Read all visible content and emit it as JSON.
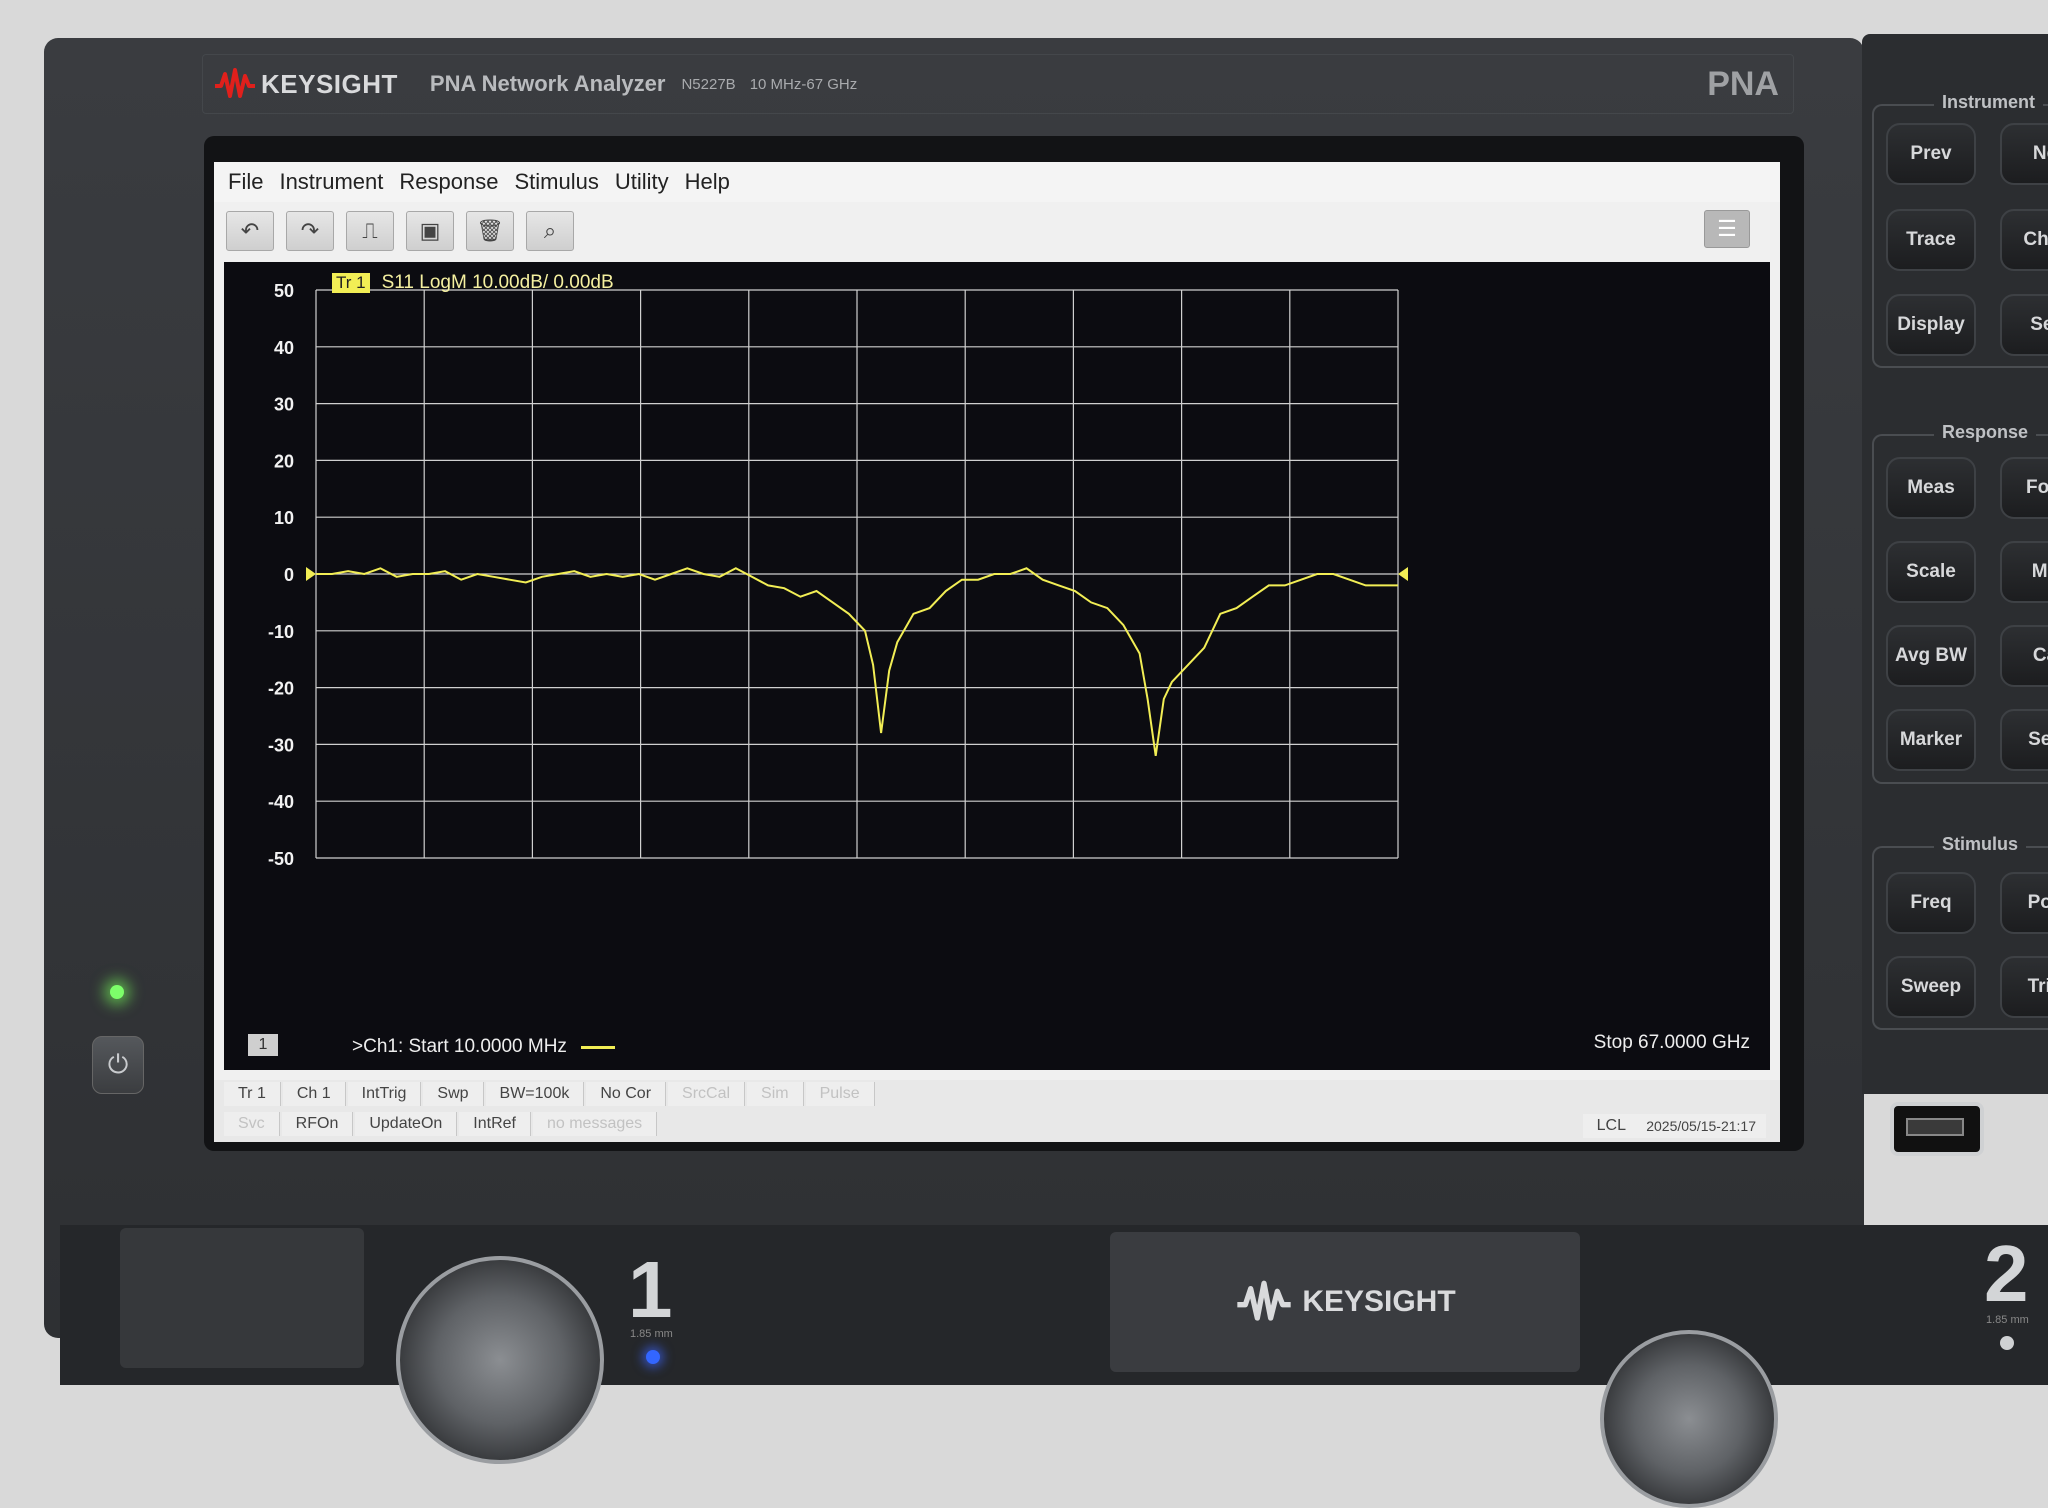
{
  "brand": {
    "name": "KEYSIGHT",
    "model": "PNA Network Analyzer",
    "part": "N5227B",
    "range": "10 MHz-67 GHz",
    "series": "PNA"
  },
  "menu": [
    "File",
    "Instrument",
    "Response",
    "Stimulus",
    "Utility",
    "Help"
  ],
  "toolbar": {
    "icons": [
      "undo-icon",
      "redo-icon",
      "add-trace-icon",
      "screen-capture-icon",
      "delete-icon",
      "zoom-icon"
    ]
  },
  "trace": {
    "badge": "Tr 1",
    "label": "S11 LogM 10.00dB/ 0.00dB",
    "color": "#f2ee55"
  },
  "channel": {
    "badge": "1",
    "start": ">Ch1:  Start  10.0000 MHz",
    "stop": "Stop  67.0000 GHz"
  },
  "status": {
    "row1": [
      {
        "text": "Tr 1",
        "dim": false
      },
      {
        "text": "Ch 1",
        "dim": false
      },
      {
        "text": "IntTrig",
        "dim": false
      },
      {
        "text": "Swp",
        "dim": false
      },
      {
        "text": "BW=100k",
        "dim": false
      },
      {
        "text": "No Cor",
        "dim": false
      },
      {
        "text": "SrcCal",
        "dim": true
      },
      {
        "text": "Sim",
        "dim": true
      },
      {
        "text": "Pulse",
        "dim": true
      }
    ],
    "row2": [
      {
        "text": "Svc",
        "dim": true
      },
      {
        "text": "RFOn",
        "dim": false
      },
      {
        "text": "UpdateOn",
        "dim": false
      },
      {
        "text": "IntRef",
        "dim": false
      },
      {
        "text": "no messages",
        "dim": true
      }
    ],
    "lcl": "LCL",
    "timestamp": "2025/05/15-21:17"
  },
  "hard_keys": {
    "instrument": {
      "title": "Instrument",
      "keys": [
        "Prev",
        "Ne",
        "Trace",
        "Char",
        "Display",
        "Set"
      ]
    },
    "response": {
      "title": "Response",
      "keys": [
        "Meas",
        "Forr",
        "Scale",
        "Ma",
        "Avg BW",
        "Ca",
        "Marker",
        "Sea"
      ]
    },
    "stimulus": {
      "title": "Stimulus",
      "keys": [
        "Freq",
        "Pov",
        "Sweep",
        "Trig"
      ]
    }
  },
  "ports": {
    "p1": "1",
    "p1_sub": "1.85 mm",
    "p2": "2",
    "p2_sub": "1.85 mm"
  },
  "power_icon": "power-icon",
  "chart_data": {
    "type": "line",
    "title": "S11 LogM 10.00dB/ 0.00dB",
    "xlabel": "",
    "ylabel": "",
    "xlim": [
      0.01,
      67.0
    ],
    "ylim": [
      -50,
      50
    ],
    "yticks": [
      50,
      40,
      30,
      20,
      10,
      0,
      -10,
      -20,
      -30,
      -40,
      -50
    ],
    "grid": true,
    "reference_level": 0,
    "series": [
      {
        "values_x": [
          0.01,
          1,
          2,
          3,
          4,
          5,
          6,
          7,
          8,
          9,
          10,
          11,
          12,
          13,
          14,
          15,
          16,
          17,
          18,
          19,
          20,
          21,
          22,
          23,
          24,
          25,
          26,
          27,
          28,
          29,
          30,
          31,
          32,
          33,
          34,
          34.5,
          35.0,
          35.5,
          36,
          37,
          38,
          39,
          40,
          41,
          42,
          43,
          44,
          45,
          46,
          47,
          48,
          49,
          50,
          51,
          51.5,
          52.0,
          52.5,
          53,
          54,
          55,
          56,
          57,
          58,
          59,
          60,
          61,
          62,
          63,
          64,
          65,
          66,
          67
        ],
        "values_y": [
          0,
          0,
          0.5,
          0,
          1,
          -0.5,
          0,
          0,
          0.5,
          -1,
          0,
          -0.5,
          -1,
          -1.5,
          -0.5,
          0,
          0.5,
          -0.5,
          0,
          -0.5,
          0,
          -1,
          0,
          1,
          0,
          -0.5,
          1,
          -0.5,
          -2,
          -2.5,
          -4,
          -3,
          -5,
          -7,
          -10,
          -16,
          -28,
          -17,
          -12,
          -7,
          -6,
          -3,
          -1,
          -1,
          0,
          0,
          1,
          -1,
          -2,
          -3,
          -5,
          -6,
          -9,
          -14,
          -22,
          -32,
          -22,
          -19,
          -16,
          -13,
          -7,
          -6,
          -4,
          -2,
          -2,
          -1,
          0,
          0,
          -1,
          -2,
          -2,
          -2
        ]
      }
    ],
    "x_start_label": "Start 10.0000 MHz",
    "x_stop_label": "Stop 67.0000 GHz"
  }
}
